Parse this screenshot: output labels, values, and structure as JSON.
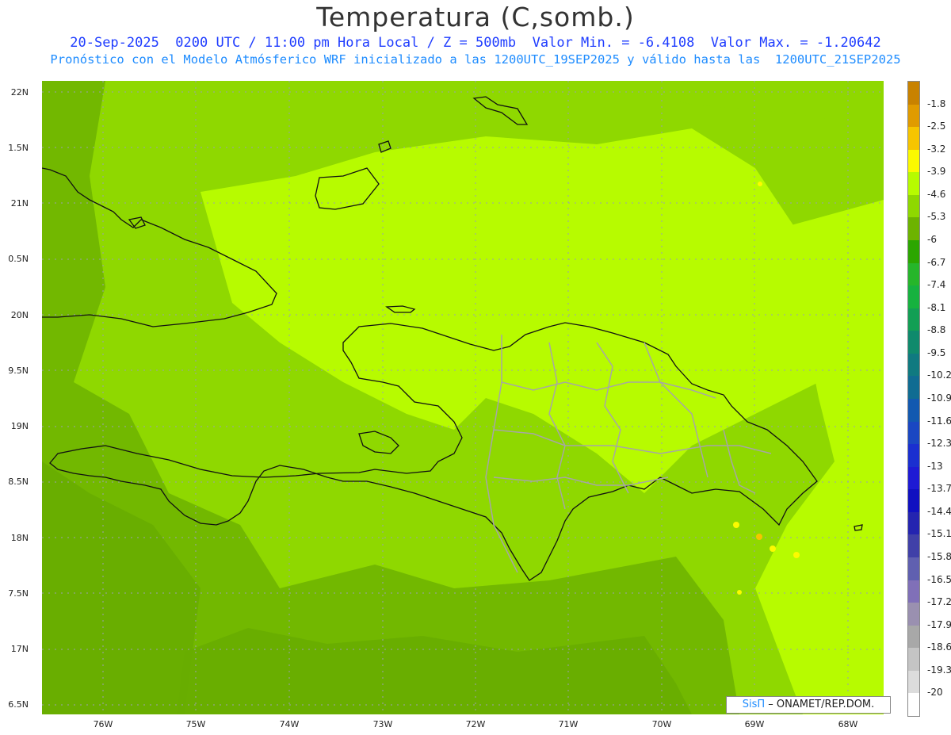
{
  "header": {
    "title": "Temperatura (C,somb.)",
    "line1": "20-Sep-2025  0200 UTC / 11:00 pm Hora Local / Z = 500mb  Valor Min. = -6.4108  Valor Max. = -1.20642",
    "line2": "Pronóstico con el Modelo Atmósferico WRF inicializado a las 1200UTC_19SEP2025 y válido hasta las  1200UTC_21SEP2025"
  },
  "axes": {
    "y_ticks": [
      "22N",
      "1.5N",
      "21N",
      "0.5N",
      "20N",
      "9.5N",
      "19N",
      "8.5N",
      "18N",
      "7.5N",
      "17N",
      "6.5N"
    ],
    "x_ticks": [
      "76W",
      "75W",
      "74W",
      "73W",
      "72W",
      "71W",
      "70W",
      "69W",
      "68W"
    ]
  },
  "colorbar": {
    "labels": [
      "-1.8",
      "-2.5",
      "-3.2",
      "-3.9",
      "-4.6",
      "-5.3",
      "-6",
      "-6.7",
      "-7.4",
      "-8.1",
      "-8.8",
      "-9.5",
      "-10.2",
      "-10.9",
      "-11.6",
      "-12.3",
      "-13",
      "-13.7",
      "-14.4",
      "-15.1",
      "-15.8",
      "-16.5",
      "-17.2",
      "-17.9",
      "-18.6",
      "-19.3",
      "-20"
    ],
    "colors": [
      "#c88200",
      "#e09b00",
      "#f6c500",
      "#fcfa00",
      "#b7fb00",
      "#8fd800",
      "#6db300",
      "#2ca600",
      "#26b62a",
      "#16b23f",
      "#129f54",
      "#0f8a6c",
      "#0f7a80",
      "#0f6c92",
      "#1259b0",
      "#1a47c2",
      "#1a2fd0",
      "#1e1ad4",
      "#1010c0",
      "#2424b0",
      "#4040a8",
      "#6060b0",
      "#8070b8",
      "#9a90b0",
      "#a8a8a8",
      "#c4c4c4",
      "#dcdcdc",
      "#ffffff"
    ]
  },
  "credit": {
    "sis": "SisΠ",
    "org": "– ONAMET/REP.DOM."
  }
}
